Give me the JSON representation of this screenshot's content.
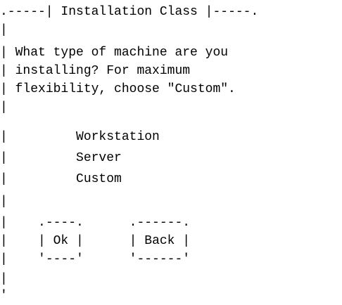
{
  "dialog": {
    "title": "Installation Class",
    "message_lines": [
      "What type of machine are you",
      "installing? For maximum",
      "flexibility, choose \"Custom\"."
    ],
    "options": [
      {
        "label": "Workstation"
      },
      {
        "label": "Server"
      },
      {
        "label": "Custom"
      }
    ],
    "buttons": {
      "ok_label": "Ok",
      "back_label": "Back"
    }
  }
}
